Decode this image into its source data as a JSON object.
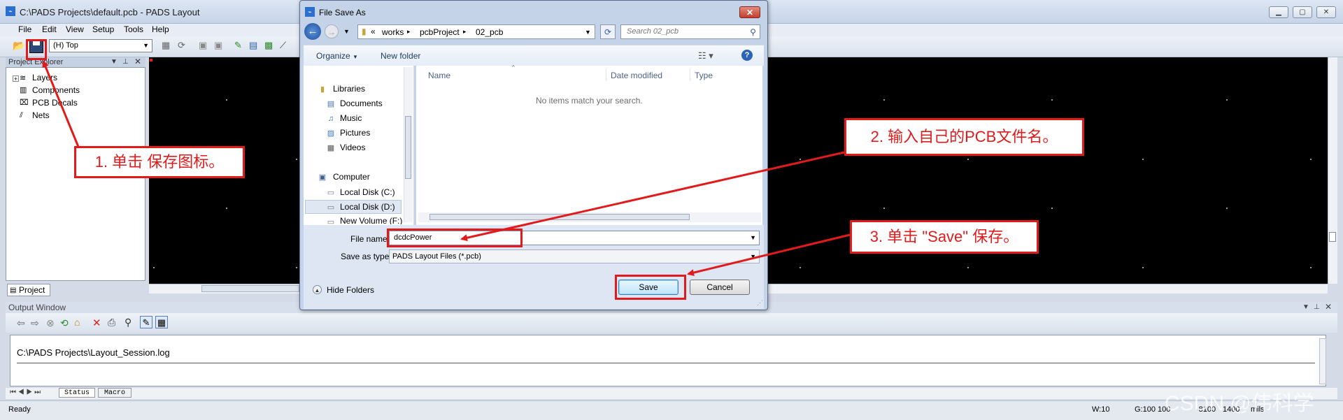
{
  "app": {
    "title": "C:\\PADS Projects\\default.pcb - PADS Layout",
    "menu": [
      "File",
      "Edit",
      "View",
      "Setup",
      "Tools",
      "Help"
    ],
    "layer": "(H) Top"
  },
  "project_explorer": {
    "title": "Project Explorer",
    "items": [
      "Layers",
      "Components",
      "PCB Decals",
      "Nets"
    ],
    "tab": "Project"
  },
  "output": {
    "title": "Output Window",
    "log": "C:\\PADS Projects\\Layout_Session.log",
    "tabs": [
      "Status",
      "Macro"
    ]
  },
  "status": {
    "ready": "Ready",
    "w": "W:10",
    "g": "G:100 100",
    "x": "-8100",
    "y": "1400",
    "units": "mils"
  },
  "dialog": {
    "title": "File Save As",
    "path": [
      "works",
      "pcbProject",
      "02_pcb"
    ],
    "search_placeholder": "Search 02_pcb",
    "organize": "Organize",
    "new_folder": "New folder",
    "nav": {
      "libraries": "Libraries",
      "lib_items": [
        "Documents",
        "Music",
        "Pictures",
        "Videos"
      ],
      "computer": "Computer",
      "drives": [
        "Local Disk (C:)",
        "Local Disk (D:)",
        "New Volume (F:)"
      ]
    },
    "columns": [
      "Name",
      "Date modified",
      "Type"
    ],
    "empty_message": "No items match your search.",
    "file_name_label": "File name:",
    "file_name_value": "dcdcPower",
    "save_type_label": "Save as type:",
    "save_type_value": "PADS Layout Files (*.pcb)",
    "hide_folders": "Hide Folders",
    "save": "Save",
    "cancel": "Cancel"
  },
  "annotations": {
    "step1": "1. 单击 保存图标。",
    "step2": "2. 输入自己的PCB文件名。",
    "step3": "3. 单击 \"Save\" 保存。",
    "color": "#e11b1b"
  },
  "watermark": "CSDN @伟科学"
}
